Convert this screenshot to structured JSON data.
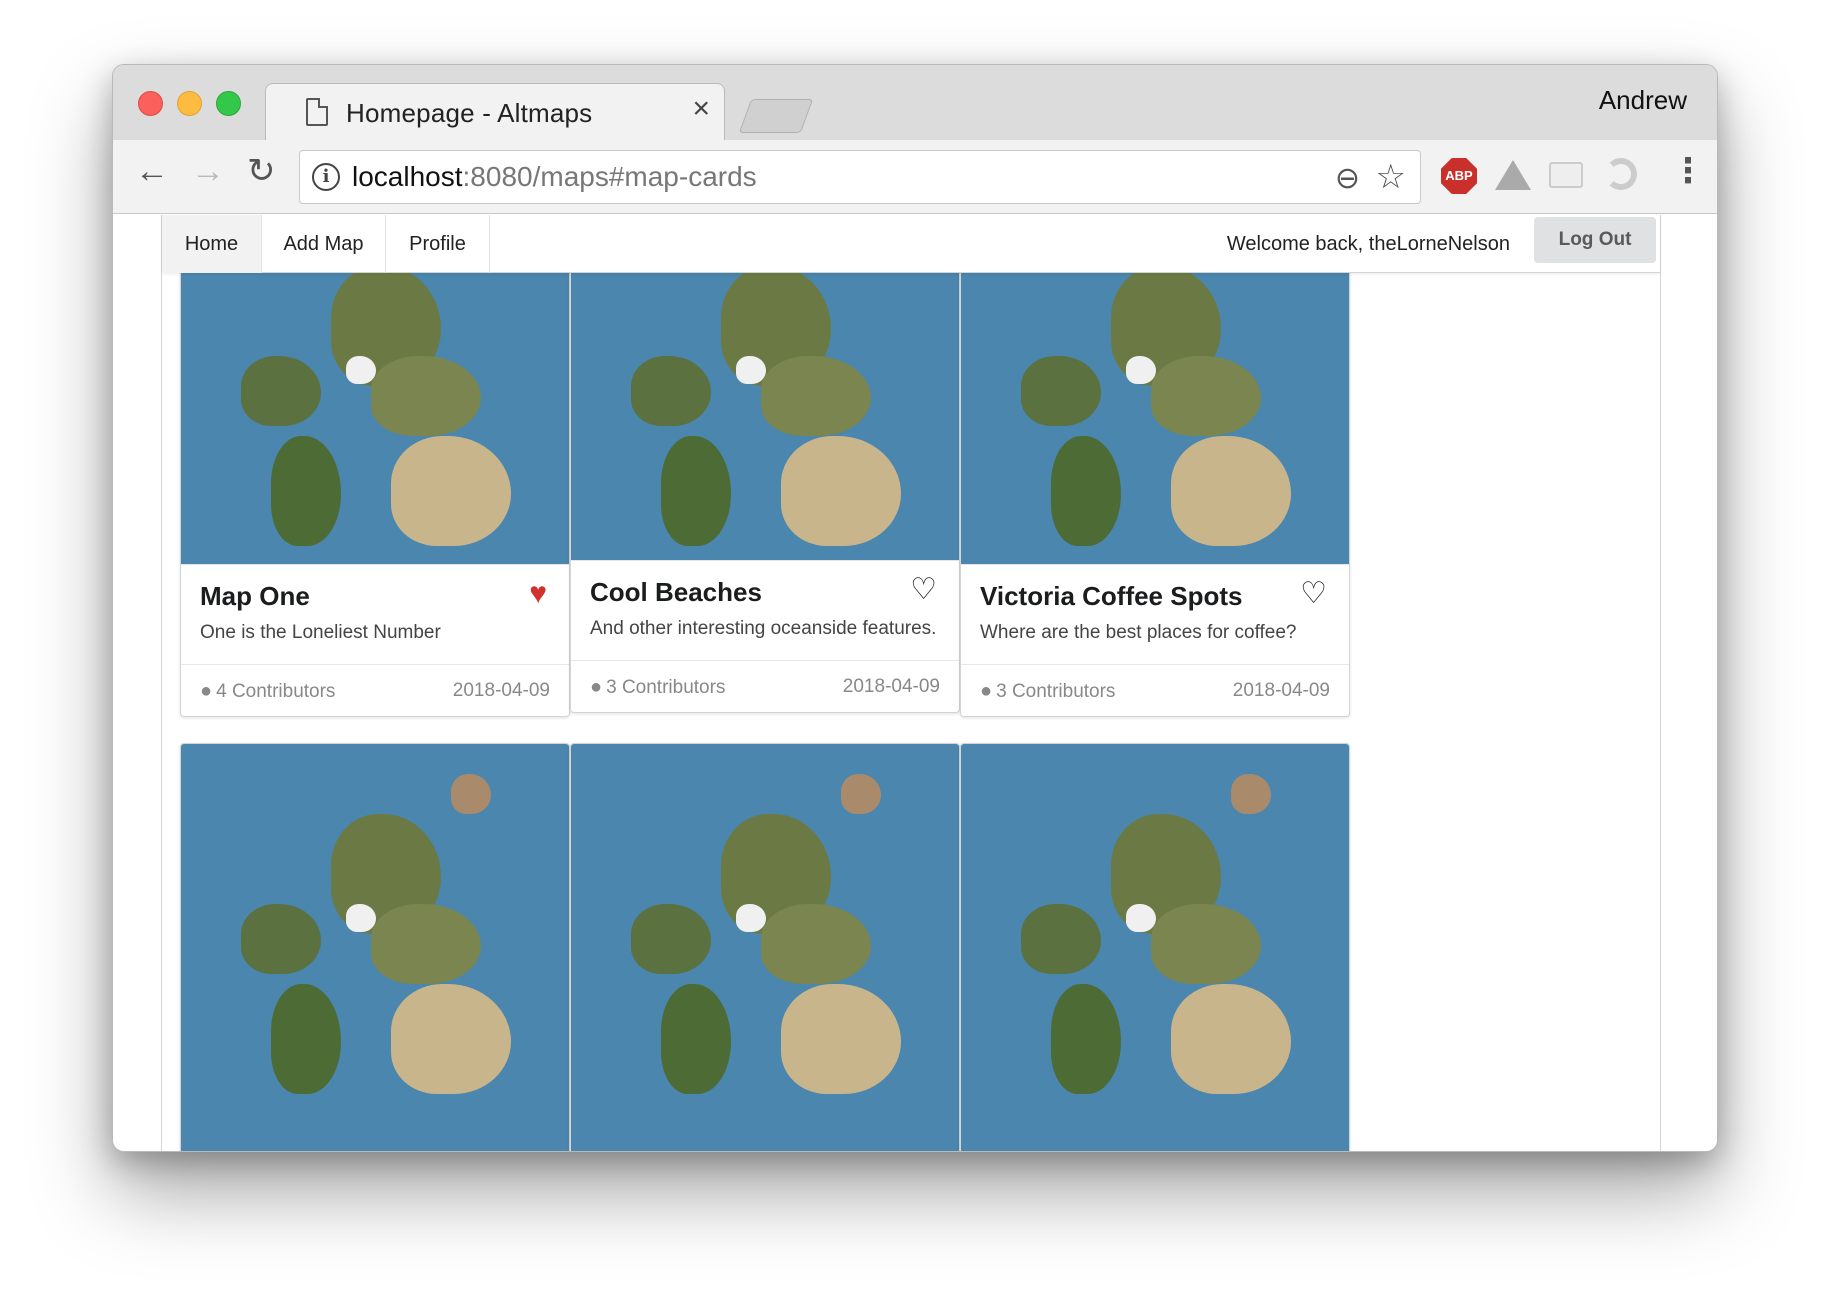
{
  "browser": {
    "tab_title": "Homepage - Altmaps",
    "tab_close": "×",
    "profile_name": "Andrew",
    "url_host": "localhost",
    "url_rest": ":8080/maps#map-cards",
    "abp_label": "ABP"
  },
  "appnav": {
    "items": [
      {
        "label": "Home"
      },
      {
        "label": "Add Map"
      },
      {
        "label": "Profile"
      }
    ],
    "welcome": "Welcome back, theLorneNelson",
    "logout_label": "Log Out"
  },
  "cards": [
    {
      "title": "Map One",
      "description": "One is the Loneliest Number",
      "contributors": "4 Contributors",
      "date": "2018-04-09",
      "favorited": true
    },
    {
      "title": "Cool Beaches",
      "description": "And other interesting oceanside features.",
      "contributors": "3 Contributors",
      "date": "2018-04-09",
      "favorited": false
    },
    {
      "title": "Victoria Coffee Spots",
      "description": "Where are the best places for coffee?",
      "contributors": "3 Contributors",
      "date": "2018-04-09",
      "favorited": false
    }
  ],
  "icons": {
    "heart_filled": "♥",
    "heart_empty": "♡",
    "user": "👤"
  },
  "colors": {
    "ocean": "#4a86ad",
    "heart_active": "#d0312d",
    "logout_bg": "#e0e1e2"
  }
}
